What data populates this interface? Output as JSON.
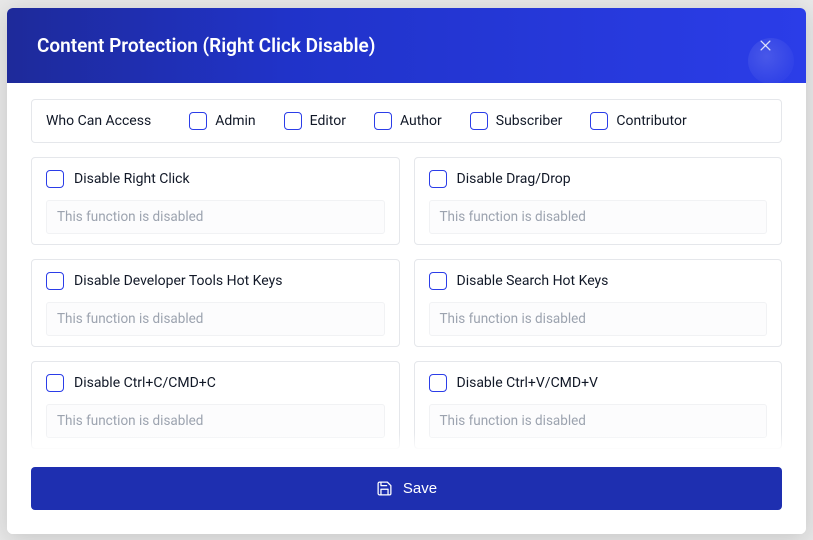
{
  "header": {
    "title": "Content Protection (Right Click Disable)"
  },
  "access": {
    "label": "Who Can Access",
    "roles": [
      {
        "label": "Admin"
      },
      {
        "label": "Editor"
      },
      {
        "label": "Author"
      },
      {
        "label": "Subscriber"
      },
      {
        "label": "Contributor"
      }
    ]
  },
  "options": [
    {
      "label": "Disable Right Click",
      "status": "This function is disabled"
    },
    {
      "label": "Disable Drag/Drop",
      "status": "This function is disabled"
    },
    {
      "label": "Disable Developer Tools Hot Keys",
      "status": "This function is disabled"
    },
    {
      "label": "Disable Search Hot Keys",
      "status": "This function is disabled"
    },
    {
      "label": "Disable Ctrl+C/CMD+C",
      "status": "This function is disabled"
    },
    {
      "label": "Disable Ctrl+V/CMD+V",
      "status": "This function is disabled"
    }
  ],
  "footer": {
    "save_label": "Save"
  }
}
